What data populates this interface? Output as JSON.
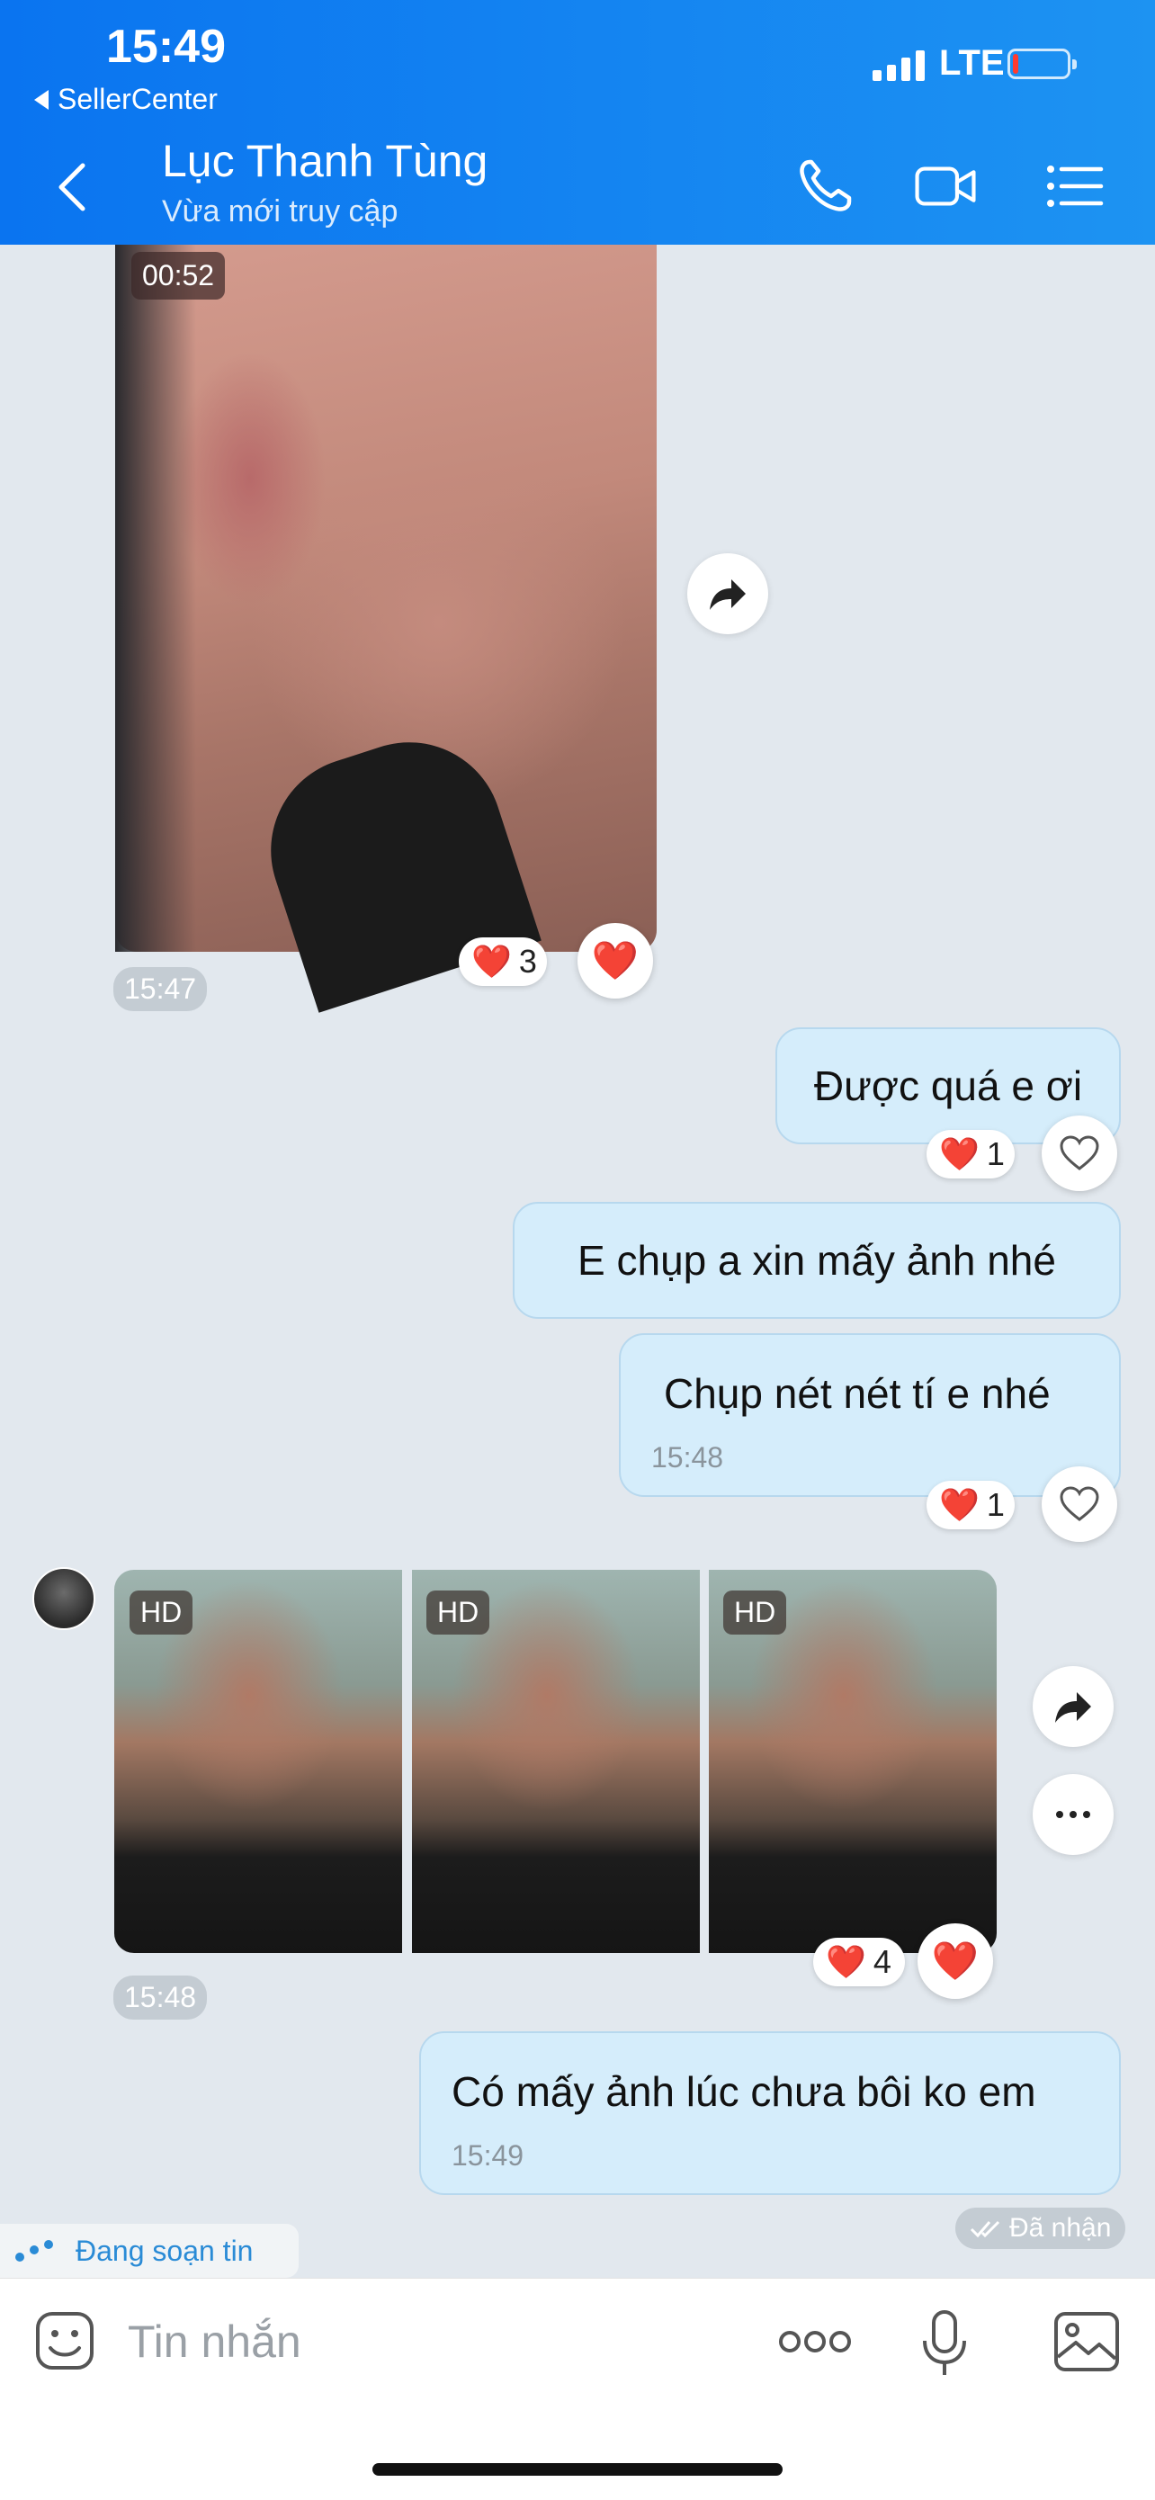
{
  "status_bar": {
    "time": "15:49",
    "back_app": "SellerCenter",
    "network": "LTE"
  },
  "header": {
    "contact_name": "Lục Thanh Tùng",
    "status": "Vừa mới truy cập",
    "icons": [
      "back-chevron-icon",
      "phone-icon",
      "video-call-icon",
      "menu-list-icon"
    ]
  },
  "messages": {
    "video": {
      "duration": "00:52",
      "reaction_count": "3",
      "time": "15:47"
    },
    "out1": {
      "text": "Được quá e ơi",
      "reaction_count": "1"
    },
    "out2": {
      "text": "E chụp a xin mấy ảnh nhé"
    },
    "out3": {
      "text": "Chụp nét nét tí e nhé",
      "time": "15:48",
      "reaction_count": "1"
    },
    "photos": {
      "badge": "HD",
      "reaction_count": "4",
      "time": "15:48"
    },
    "out4": {
      "text": "Có mấy ảnh lúc chưa bôi ko em",
      "time": "15:49"
    }
  },
  "typing_indicator": "Đang soạn tin",
  "delivery_status": "Đã nhận",
  "composer": {
    "placeholder": "Tin nhắn"
  },
  "colors": {
    "header_start": "#0a74f0",
    "header_end": "#1d93f2",
    "bubble_out": "#d5edfb",
    "chat_bg": "#e2e8ee"
  }
}
